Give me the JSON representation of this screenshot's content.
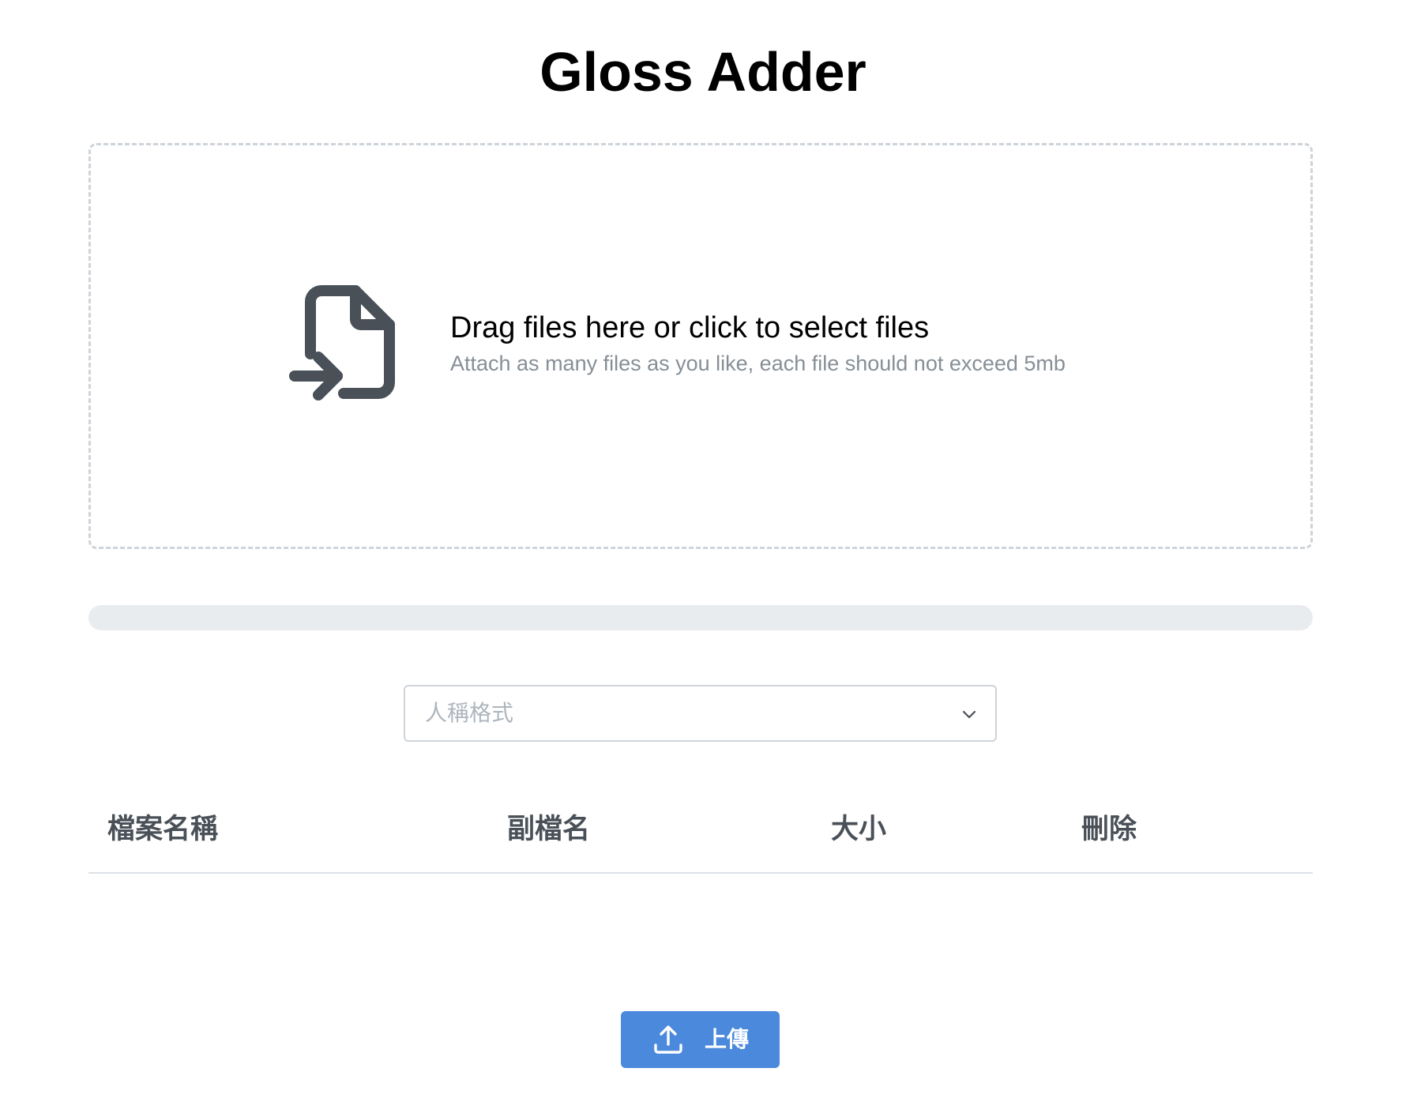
{
  "page": {
    "title": "Gloss Adder"
  },
  "dropzone": {
    "icon": "file-import-icon",
    "title": "Drag files here or click to select files",
    "subtitle": "Attach as many files as you like, each file should not exceed 5mb"
  },
  "progress": {
    "value_percent": 0
  },
  "format_select": {
    "placeholder": "人稱格式",
    "icon": "chevron-down-icon"
  },
  "file_table": {
    "columns": [
      "檔案名稱",
      "副檔名",
      "大小",
      "刪除"
    ],
    "rows": []
  },
  "upload_button": {
    "label": "上傳",
    "icon": "upload-icon",
    "color": "#4a89dc"
  },
  "colors": {
    "border": "#ced4da",
    "muted_text": "#868e96",
    "progress_track": "#e9ecef",
    "header_text": "#495057"
  }
}
